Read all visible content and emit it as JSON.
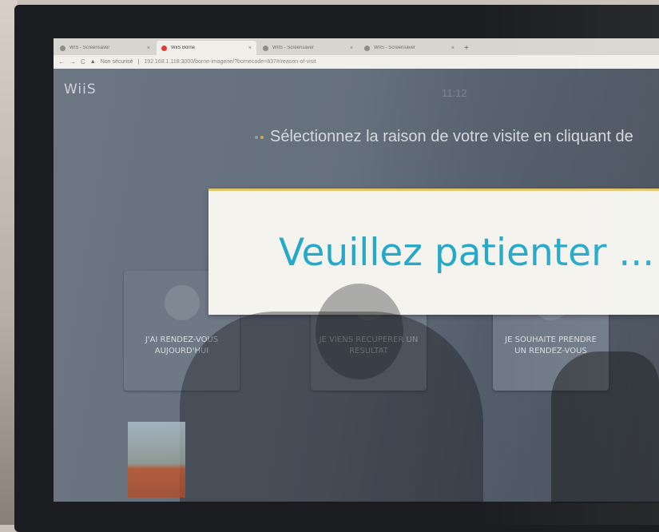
{
  "browser": {
    "tabs": [
      {
        "title": "WIS - Screensaver",
        "close": "×",
        "active": false
      },
      {
        "title": "WiiS Borne",
        "close": "×",
        "active": true
      },
      {
        "title": "WIIS - Screensaver",
        "close": "×",
        "active": false
      },
      {
        "title": "WIIS - Screensaver",
        "close": "×",
        "active": false
      }
    ],
    "new_tab": "+",
    "nav": {
      "back": "←",
      "forward": "→",
      "reload": "C"
    },
    "security_warning": "Non sécurisé",
    "url": "192.168.1.118:3000/borne-imagene/?bornecode=837#/reason-of-visit"
  },
  "app": {
    "logo": "WiiS",
    "clock": "11:12",
    "instruction": "Sélectionnez la raison de votre visite en cliquant de",
    "cards": [
      {
        "label": "J'AI RENDEZ-VOUS AUJOURD'HUI"
      },
      {
        "label": "JE VIENS RECUPERER UN RESULTAT"
      },
      {
        "label": "JE SOUHAITE PRENDRE UN RENDEZ-VOUS"
      }
    ],
    "overlay_message": "Veuillez patienter ..."
  },
  "colors": {
    "overlay_text": "#26a9c8",
    "overlay_bg": "#f4f3ee",
    "overlay_border": "#e3c46a",
    "active_tab_favicon": "#e53935"
  }
}
